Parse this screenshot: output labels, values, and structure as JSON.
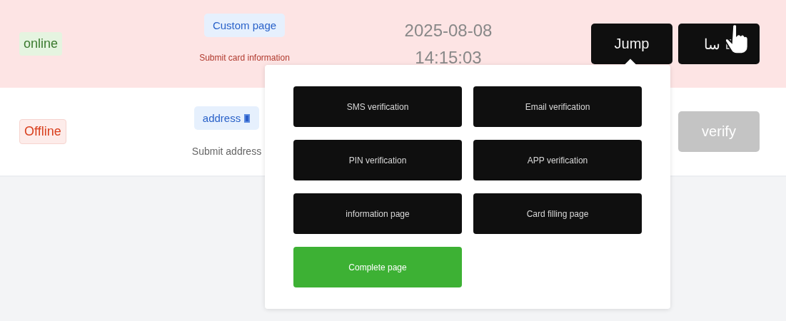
{
  "rows": [
    {
      "highlighted": true,
      "status": {
        "label": "online",
        "kind": "online"
      },
      "tag": {
        "label": "Custom page"
      },
      "note": "Submit card information",
      "date": "2025-08-08",
      "time": "14:15:03",
      "actions": [
        {
          "label": "Jump",
          "disabled": false
        },
        {
          "label": "سا",
          "disabled": false,
          "icon": true
        }
      ]
    },
    {
      "highlighted": false,
      "status": {
        "label": "Offline",
        "kind": "offline"
      },
      "tag": {
        "label": "address",
        "icon": true
      },
      "note": "Submit address",
      "actions": [
        {
          "label": "verify",
          "disabled": true
        }
      ]
    }
  ],
  "jump_menu": {
    "options": [
      {
        "label": "SMS verification",
        "kind": "dark"
      },
      {
        "label": "Email verification",
        "kind": "dark"
      },
      {
        "label": "PIN verification",
        "kind": "dark"
      },
      {
        "label": "APP verification",
        "kind": "dark"
      },
      {
        "label": "information page",
        "kind": "dark"
      },
      {
        "label": "Card filling page",
        "kind": "dark"
      },
      {
        "label": "Complete page",
        "kind": "success"
      }
    ]
  }
}
